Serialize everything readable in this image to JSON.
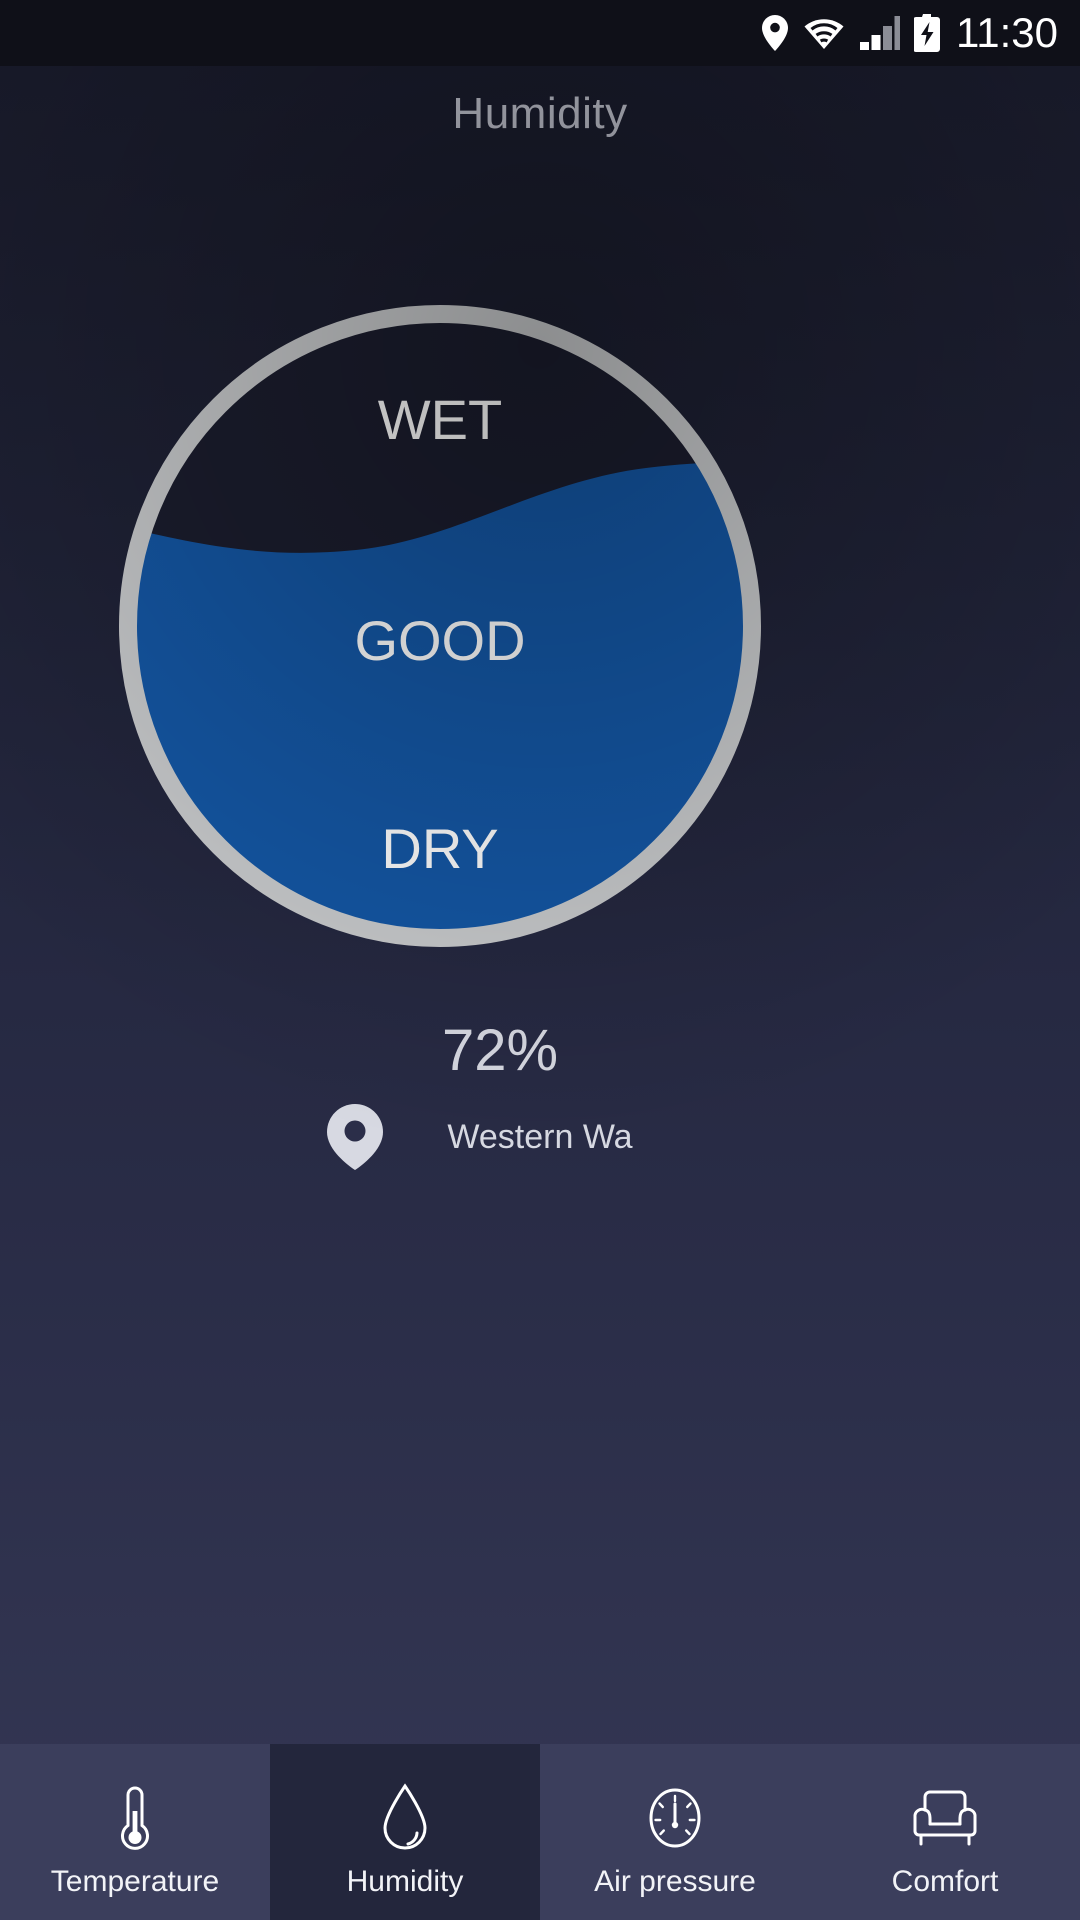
{
  "status_bar": {
    "icons": [
      "location-pin-icon",
      "wifi-icon",
      "cellular-signal-icon",
      "battery-charging-icon"
    ],
    "time": "11:30"
  },
  "header": {
    "title": "Humidity"
  },
  "gauge": {
    "type": "liquid-fill-circle",
    "fill_percent": 72,
    "fill_color": "#1457a5",
    "ring_color": "#c9cbcd",
    "empty_color": "#1b1d2e",
    "zone_labels": [
      {
        "text": "WET",
        "zone": "wet"
      },
      {
        "text": "GOOD",
        "zone": "good"
      },
      {
        "text": "DRY",
        "zone": "dry"
      }
    ]
  },
  "readout": {
    "value": "72",
    "unit": "%",
    "location_icon": "location-pin-icon",
    "location_name": "Western Wa"
  },
  "tabbar": {
    "active_index": 1,
    "items": [
      {
        "label": "Temperature",
        "icon": "thermometer-icon"
      },
      {
        "label": "Humidity",
        "icon": "water-droplet-icon"
      },
      {
        "label": "Air pressure",
        "icon": "barometer-gauge-icon"
      },
      {
        "label": "Comfort",
        "icon": "armchair-icon"
      }
    ]
  },
  "colors": {
    "accent_blue": "#1457a5",
    "ring_gray": "#c9cbcd",
    "tab_bg": "#3b3e5c",
    "tab_active_bg": "#23263c",
    "text_primary": "#f2f3f7",
    "text_muted": "#b9bbc6"
  }
}
